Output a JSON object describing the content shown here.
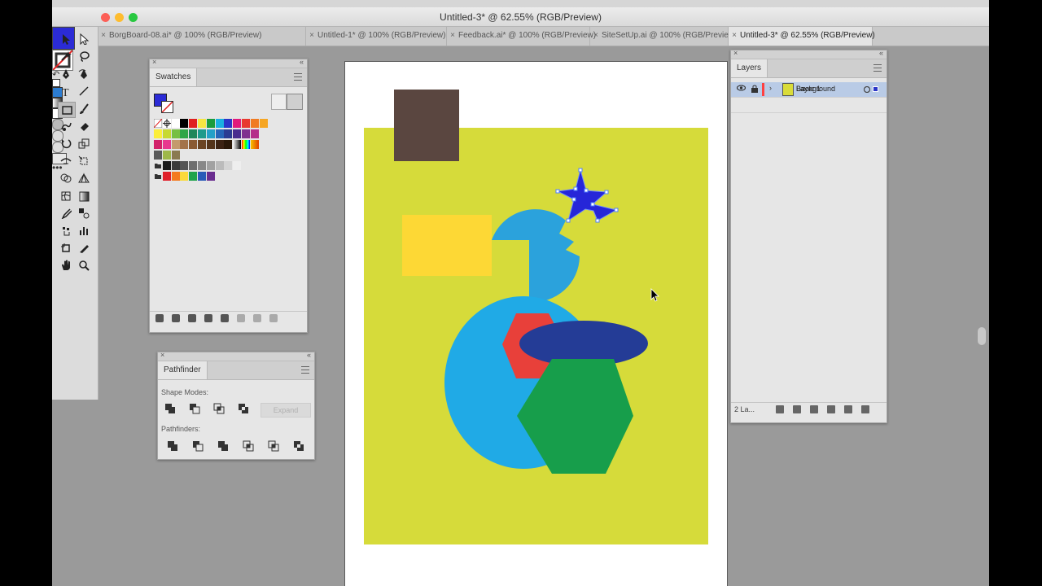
{
  "window": {
    "title": "Untitled-3* @ 62.55% (RGB/Preview)",
    "traffic_lights": {
      "close": "#fc5f57",
      "minimize": "#febc2e",
      "zoom": "#28c840"
    }
  },
  "tabs": [
    {
      "label": "BorgBoard-08.ai* @ 100% (RGB/Preview)",
      "active": false
    },
    {
      "label": "Untitled-1* @ 100% (RGB/Preview)",
      "active": false
    },
    {
      "label": "Feedback.ai* @ 100% (RGB/Preview)",
      "active": false
    },
    {
      "label": "SiteSetUp.ai @ 100% (RGB/Preview)",
      "active": false
    },
    {
      "label": "Untitled-3* @ 62.55% (RGB/Preview)",
      "active": true
    }
  ],
  "tools": [
    "selection-tool",
    "direct-selection-tool",
    "magic-wand-tool",
    "lasso-tool",
    "pen-tool",
    "curvature-tool",
    "type-tool",
    "line-segment-tool",
    "rectangle-tool",
    "paintbrush-tool",
    "shaper-tool",
    "eraser-tool",
    "rotate-tool",
    "scale-tool",
    "width-tool",
    "free-transform-tool",
    "shape-builder-tool",
    "perspective-grid-tool",
    "mesh-tool",
    "gradient-tool",
    "eyedropper-tool",
    "blend-tool",
    "symbol-sprayer-tool",
    "column-graph-tool",
    "artboard-tool",
    "slice-tool",
    "hand-tool",
    "zoom-tool"
  ],
  "colors": {
    "fill": "#2b2bd6",
    "stroke": "none",
    "canvas_bg": "#9a9a9a",
    "artboard": "#ffffff",
    "panel_bg": "#e6e6e6",
    "highlight_row": "#b9cbe6"
  },
  "swatches": {
    "tab_label": "Swatches",
    "rows": [
      [
        "none",
        "register",
        "#ffffff",
        "#000000",
        "#e02020",
        "#f5e642",
        "#1a9c3c",
        "#1bb0e0",
        "#2b36c8",
        "#e21a7c",
        "#e83a2f",
        "#f07b22",
        "#f6a623"
      ],
      [
        "#fbee3a",
        "#c7d930",
        "#77c043",
        "#2fa647",
        "#20875a",
        "#1d9a8c",
        "#24a0c8",
        "#2766b8",
        "#2b3c93",
        "#4a2d8f",
        "#7f2f8f",
        "#b52e8a"
      ],
      [
        "#d2216a",
        "#e8388f",
        "#c49a6c",
        "#a3734a",
        "#8a5a32",
        "#6b4423",
        "#54341a",
        "#3c2313",
        "#2a1808",
        "gradient-bw",
        "gradient-rainbow",
        "gradient-orange"
      ],
      [
        "pattern-1",
        "pattern-2",
        "pattern-3"
      ],
      [
        "folder",
        "#1a1a1a",
        "#3a3a3a",
        "#555555",
        "#6e6e6e",
        "#888888",
        "#a1a1a1",
        "#bbbbbb",
        "#d4d4d4",
        "#eeeeee"
      ],
      [
        "folder",
        "#e0202a",
        "#f47a20",
        "#fbd93a",
        "#1fa34b",
        "#2a5bb8",
        "#6a2d8f"
      ]
    ]
  },
  "pathfinder": {
    "tab_label": "Pathfinder",
    "shape_modes_label": "Shape Modes:",
    "expand_label": "Expand",
    "pathfinders_label": "Pathfinders:",
    "shape_mode_buttons": [
      "unite",
      "minus-front",
      "intersect",
      "exclude"
    ],
    "pathfinder_buttons": [
      "divide",
      "trim",
      "merge",
      "crop",
      "outline",
      "minus-back"
    ]
  },
  "layers": {
    "tab_label": "Layers",
    "items": [
      {
        "name": "Layer 1",
        "color": "#4f7fff",
        "thumb": "#4aa3d8",
        "selected": true,
        "locked": false
      },
      {
        "name": "Background",
        "color": "#ff4040",
        "thumb": "#d9dc3a",
        "selected": false,
        "locked": true
      }
    ],
    "count_label": "2 La..."
  },
  "artwork": {
    "background_rect": "#d6db3a",
    "brown_square": "#5a4640",
    "yellow_rect": "#fdd835",
    "blue_pacman": "#2ba2dc",
    "selected_star": "#2626d8",
    "big_circle": "#20aae6",
    "red_hexagon": "#e8403a",
    "navy_ellipse": "#243c96",
    "green_hexagon": "#179e4b"
  }
}
